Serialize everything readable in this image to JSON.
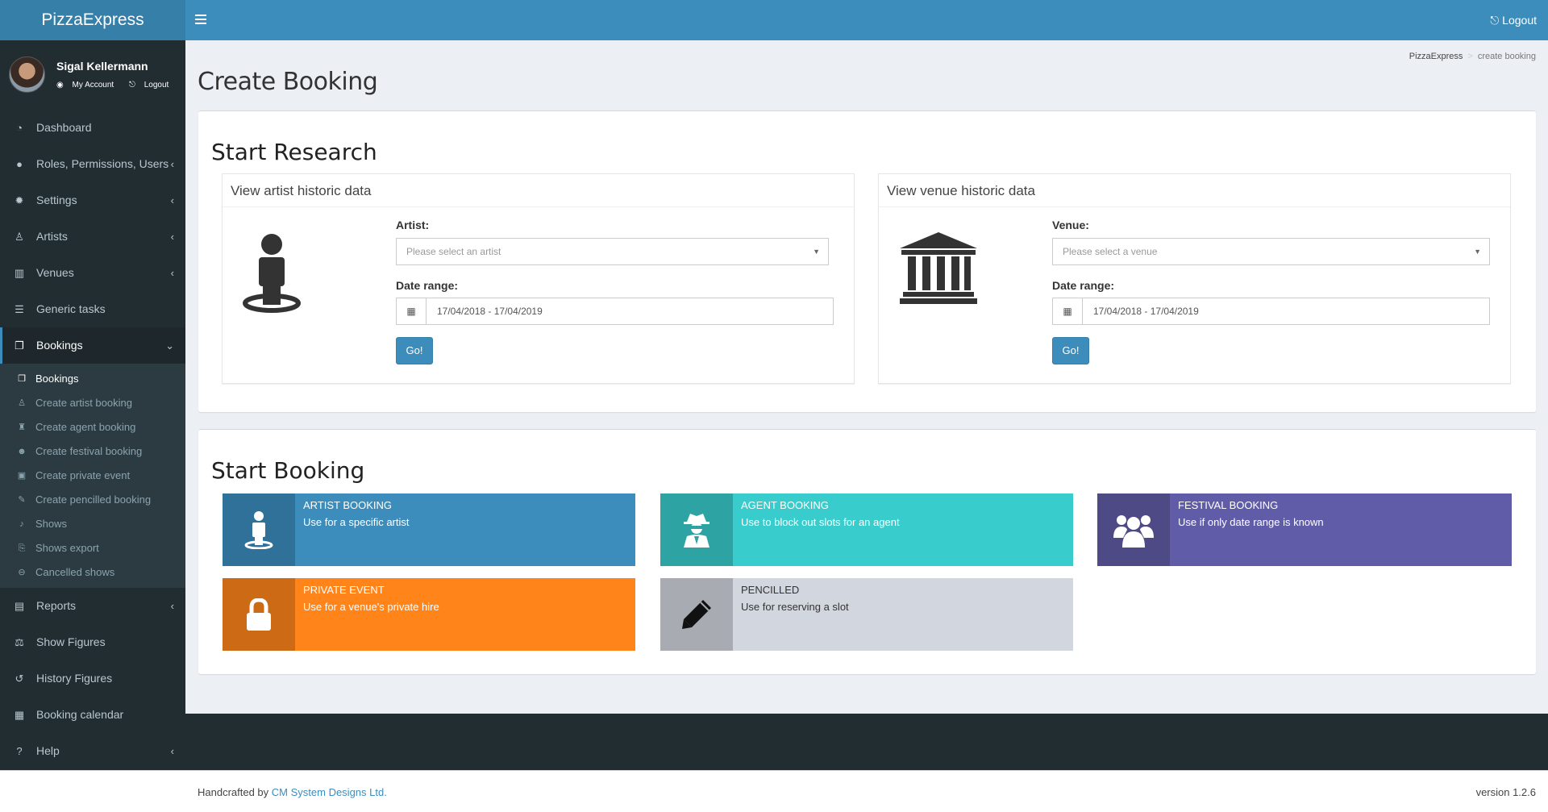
{
  "header": {
    "brand": "PizzaExpress",
    "logout": "Logout"
  },
  "user": {
    "name": "Sigal Kellermann",
    "my_account": "My Account",
    "logout": "Logout"
  },
  "sidebar": {
    "items": [
      {
        "label": "Dashboard",
        "icon": "dashboard-icon"
      },
      {
        "label": "Roles, Permissions, Users",
        "icon": "user-circle-icon"
      },
      {
        "label": "Settings",
        "icon": "gear-icon"
      },
      {
        "label": "Artists",
        "icon": "person-icon"
      },
      {
        "label": "Venues",
        "icon": "bank-icon"
      },
      {
        "label": "Generic tasks",
        "icon": "tasks-icon"
      },
      {
        "label": "Bookings",
        "icon": "files-icon"
      },
      {
        "label": "Reports",
        "icon": "book-icon"
      },
      {
        "label": "Show Figures",
        "icon": "scale-icon"
      },
      {
        "label": "History Figures",
        "icon": "history-icon"
      },
      {
        "label": "Booking calendar",
        "icon": "calendar-icon"
      },
      {
        "label": "Help",
        "icon": "question-icon"
      }
    ],
    "bookings_sub": [
      {
        "label": "Bookings"
      },
      {
        "label": "Create artist booking"
      },
      {
        "label": "Create agent booking"
      },
      {
        "label": "Create festival booking"
      },
      {
        "label": "Create private event"
      },
      {
        "label": "Create pencilled booking"
      },
      {
        "label": "Shows"
      },
      {
        "label": "Shows export"
      },
      {
        "label": "Cancelled shows"
      }
    ]
  },
  "breadcrumb": {
    "home": "PizzaExpress",
    "current": "create booking"
  },
  "page": {
    "title": "Create Booking"
  },
  "research": {
    "title": "Start Research",
    "artist": {
      "heading": "View artist historic data",
      "field_label": "Artist:",
      "placeholder": "Please select an artist",
      "date_label": "Date range:",
      "date_value": "17/04/2018 - 17/04/2019",
      "go": "Go!"
    },
    "venue": {
      "heading": "View venue historic data",
      "field_label": "Venue:",
      "placeholder": "Please select a venue",
      "date_label": "Date range:",
      "date_value": "17/04/2018 - 17/04/2019",
      "go": "Go!"
    }
  },
  "booking": {
    "title": "Start Booking",
    "tiles": [
      {
        "title": "ARTIST BOOKING",
        "sub": "Use for a specific artist",
        "color": "#3c8dbc",
        "icon_bg": "#30719a"
      },
      {
        "title": "AGENT BOOKING",
        "sub": "Use to block out slots for an agent",
        "color": "#39cccc",
        "icon_bg": "#2ea3a3"
      },
      {
        "title": "FESTIVAL BOOKING",
        "sub": "Use if only date range is known",
        "color": "#605ca8",
        "icon_bg": "#4d4a86"
      },
      {
        "title": "PRIVATE EVENT",
        "sub": "Use for a venue's private hire",
        "color": "#ff851b",
        "icon_bg": "#cc6a16"
      },
      {
        "title": "PENCILLED",
        "sub": "Use for reserving a slot",
        "color": "#d2d6de",
        "icon_bg": "#a8abb2"
      }
    ]
  },
  "footer": {
    "prefix": "Handcrafted by ",
    "company": "CM System Designs Ltd.",
    "version": "version 1.2.6"
  }
}
